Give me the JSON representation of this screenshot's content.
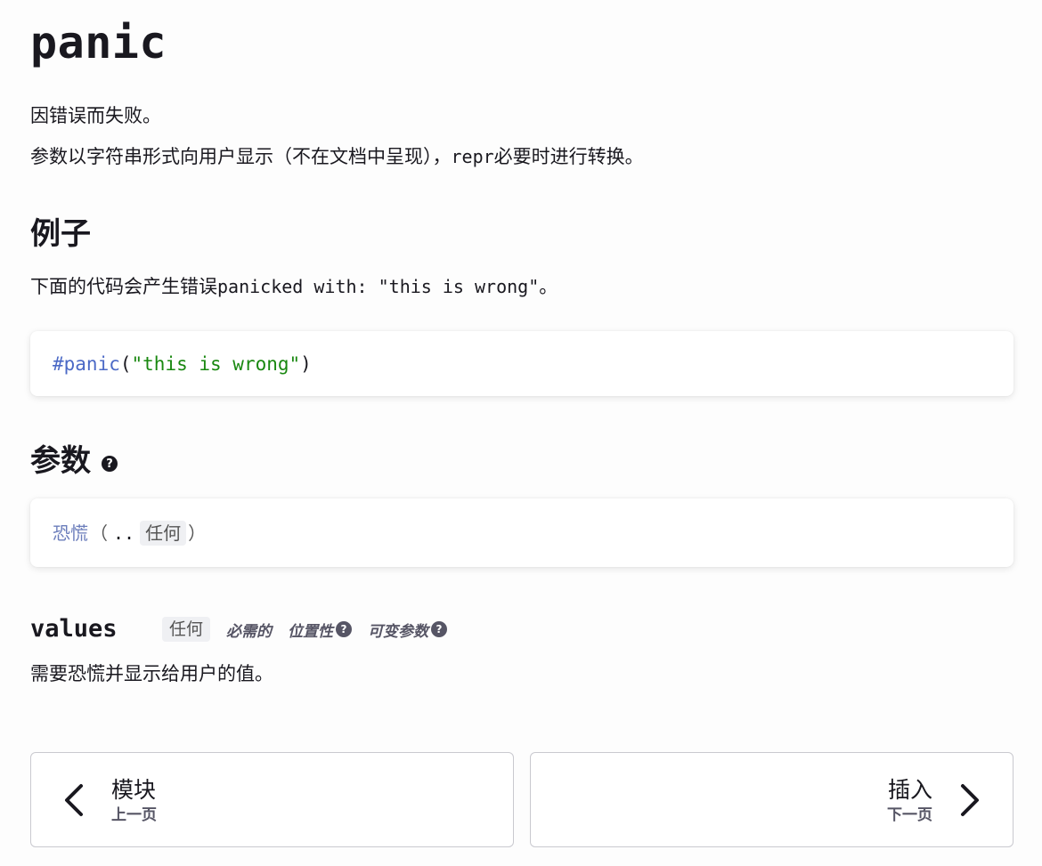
{
  "page": {
    "title": "panic",
    "summary": "因错误而失败。",
    "description_before": "参数以字符串形式向用户显示（不在文档中呈现），",
    "description_code": "repr",
    "description_after": "必要时进行转换。"
  },
  "example": {
    "heading": "例子",
    "intro_before": "下面的代码会产生错误",
    "intro_code": "panicked with: \"this is wrong\"",
    "intro_after": "。",
    "code": {
      "fn": "#panic",
      "open": "(",
      "string": "\"this is wrong\"",
      "close": ")"
    }
  },
  "params": {
    "heading": "参数",
    "help_icon": "question-circle-icon",
    "signature": {
      "fn": "恐慌",
      "open": "（",
      "dots": "..",
      "type": "任何",
      "close": "）"
    },
    "items": [
      {
        "name": "values",
        "type": "任何",
        "flags": [
          "必需的",
          "位置性",
          "可变参数"
        ],
        "description": "需要恐慌并显示给用户的值。"
      }
    ]
  },
  "nav": {
    "prev": {
      "title": "模块",
      "subtitle": "上一页",
      "icon": "chevron-left-icon"
    },
    "next": {
      "title": "插入",
      "subtitle": "下一页",
      "icon": "chevron-right-icon"
    }
  }
}
